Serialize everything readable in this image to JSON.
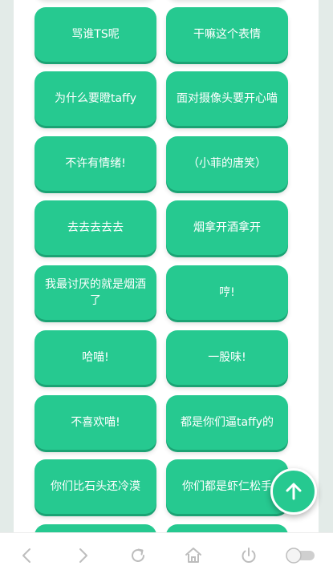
{
  "buttons": [
    {
      "label": ""
    },
    {
      "label": ""
    },
    {
      "label": "骂谁TS呢"
    },
    {
      "label": "干嘛这个表情"
    },
    {
      "label": "为什么要瞪taffy"
    },
    {
      "label": "面对摄像头要开心喵"
    },
    {
      "label": "不许有情绪!"
    },
    {
      "label": "（小菲的唐笑）"
    },
    {
      "label": "去去去去去"
    },
    {
      "label": "烟拿开酒拿开"
    },
    {
      "label": "我最讨厌的就是烟酒了"
    },
    {
      "label": "哼!"
    },
    {
      "label": "哈喵!"
    },
    {
      "label": "一股味!"
    },
    {
      "label": "不喜欢喵!"
    },
    {
      "label": "都是你们逼taffy的"
    },
    {
      "label": "你们比石头还冷漠"
    },
    {
      "label": "你们都是虾仁松手"
    },
    {
      "label": ""
    },
    {
      "label": ""
    }
  ],
  "fab": {
    "icon": "arrow-up-icon"
  },
  "navbar": {
    "items": [
      {
        "icon": "back-icon"
      },
      {
        "icon": "forward-icon"
      },
      {
        "icon": "reload-icon"
      },
      {
        "icon": "home-icon"
      },
      {
        "icon": "power-icon"
      },
      {
        "icon": "toggle-icon"
      }
    ]
  },
  "colors": {
    "button": "#26c990",
    "button_shadow": "#1ba374",
    "page_bg": "#ffffff",
    "outer_bg": "#e3ebe8",
    "nav_icon": "#bdbdbd"
  }
}
